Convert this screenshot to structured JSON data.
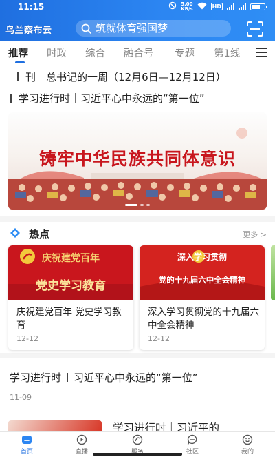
{
  "status_bar": {
    "time": "11:15",
    "net_speed": "5.00",
    "net_unit": "KB/s",
    "hd": "HD",
    "signal_1": "4G",
    "signal_2": "4G"
  },
  "header": {
    "logo": "乌兰察布云",
    "search_placeholder": "筑就体育强国梦",
    "accent": "#1f6fe0"
  },
  "tabs": [
    {
      "label": "推荐",
      "active": true
    },
    {
      "label": "时政"
    },
    {
      "label": "综合"
    },
    {
      "label": "融合号"
    },
    {
      "label": "专题"
    },
    {
      "label": "第1线"
    }
  ],
  "ticker": [
    {
      "text": "刊｜总书记的一周（12月6日—12月12日）"
    },
    {
      "text": "学习进行时｜习近平心中永远的“第一位”"
    }
  ],
  "banner": {
    "title": "铸牢中华民族共同体意识"
  },
  "hot": {
    "title": "热点",
    "more": "更多 >",
    "cards": [
      {
        "image_line1": "庆祝建党百年",
        "image_line2": "党史学习教育",
        "title": "庆祝建党百年 党史学习教育",
        "date": "12-12"
      },
      {
        "image_line1": "深入学习贯彻",
        "image_line2": "党的十九届六中全会精神",
        "title": "深入学习贯彻党的十九届六中全会精神",
        "date": "12-12"
      }
    ]
  },
  "articles": [
    {
      "title_a": "学习进行时",
      "title_b": "习近平心中永远的“第一位”",
      "date": "11-09"
    },
    {
      "title": "学习进行时｜习近平的"
    }
  ],
  "bottom_nav": [
    {
      "label": "首页",
      "icon": "home-icon",
      "active": true
    },
    {
      "label": "直播",
      "icon": "live-icon"
    },
    {
      "label": "服务",
      "icon": "service-icon"
    },
    {
      "label": "社区",
      "icon": "community-icon"
    },
    {
      "label": "我的",
      "icon": "profile-icon"
    }
  ]
}
